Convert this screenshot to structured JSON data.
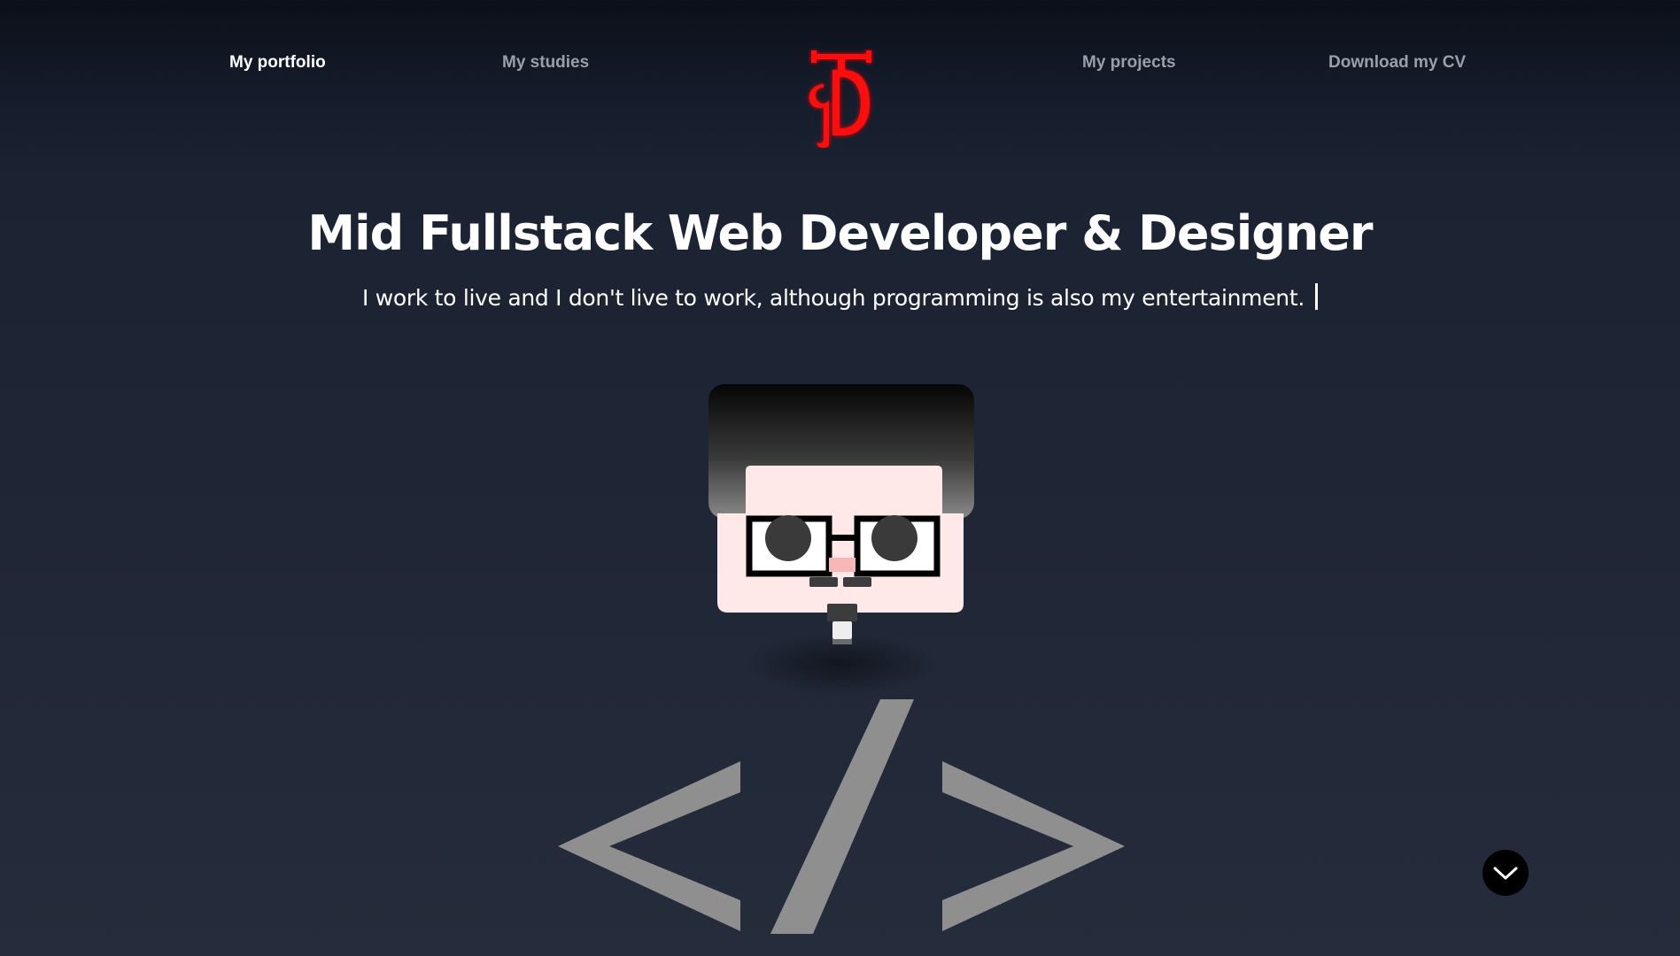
{
  "nav": {
    "items": [
      {
        "label": "My portfolio",
        "active": true
      },
      {
        "label": "My studies",
        "active": false
      },
      {
        "label": "My projects",
        "active": false
      },
      {
        "label": "Download my CV",
        "active": false
      }
    ],
    "logo_icon": "jd-monogram-logo-icon",
    "logo_color": "#ff0a0a"
  },
  "hero": {
    "title": "Mid Fullstack Web Developer & Designer",
    "subtitle": "I work to live and I don't live to work, although programming is also my entertainment."
  },
  "illustration": {
    "avatar_icon": "developer-avatar-illustration",
    "code_icon": "code-tag-icon",
    "code_text": "</>"
  },
  "scroll_button": {
    "icon": "chevron-down-icon"
  },
  "colors": {
    "accent": "#ff0a0a",
    "nav_inactive": "#9aa0a8",
    "nav_active": "#ffffff",
    "code_symbol": "#8f8f8f"
  }
}
